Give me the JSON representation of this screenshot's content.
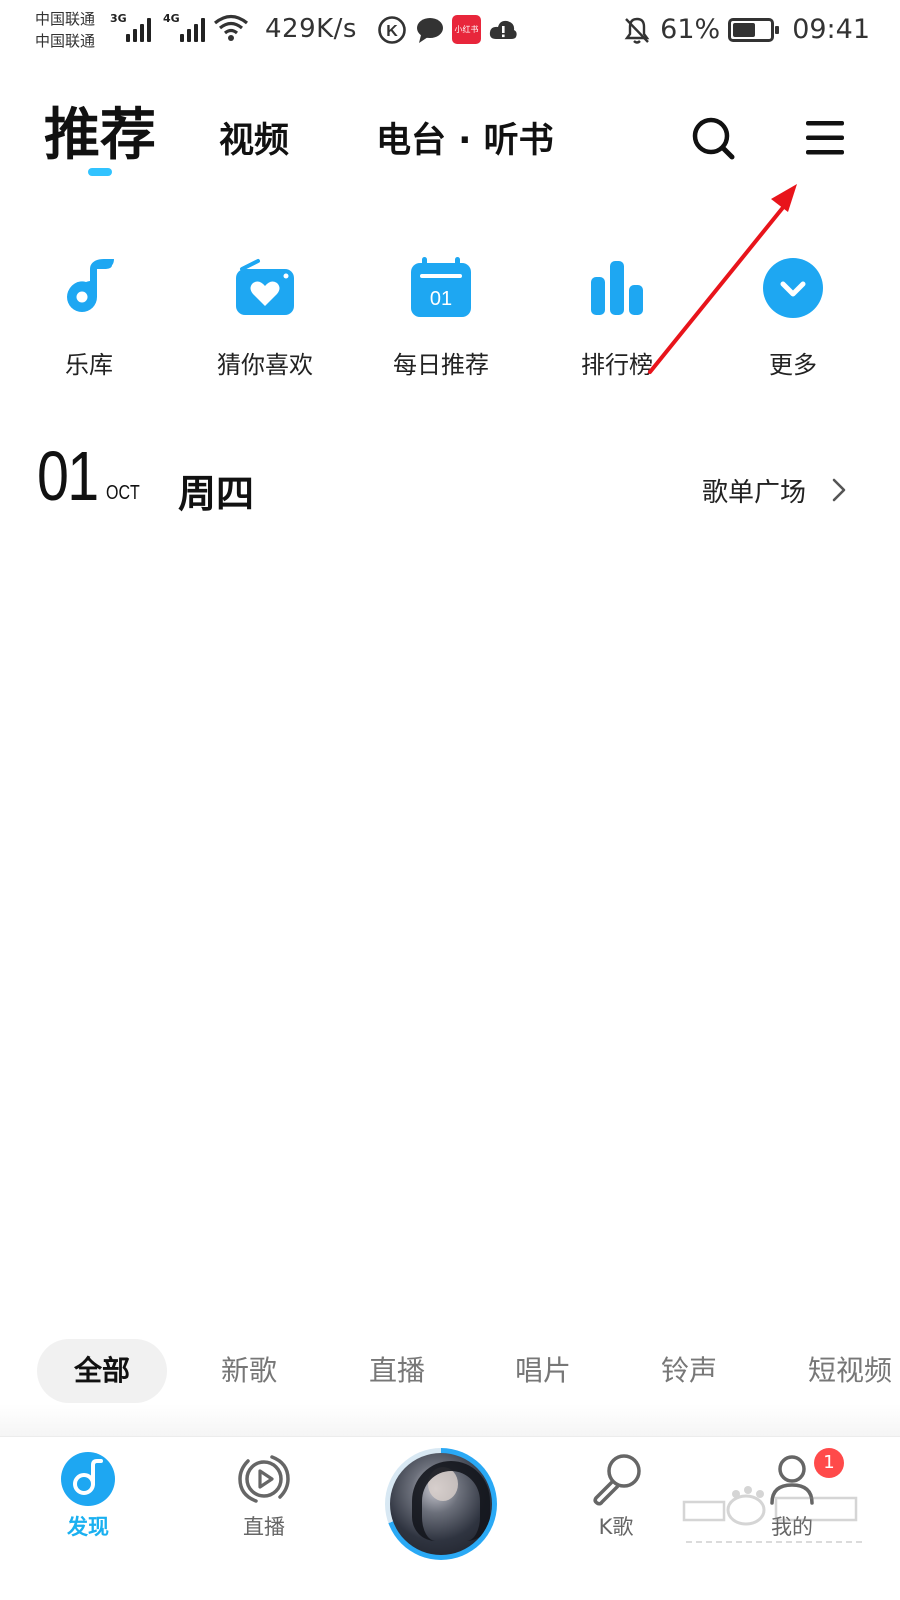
{
  "status_bar": {
    "carrier_1": "中国联通",
    "carrier_2": "中国联通",
    "network_1": "3G",
    "network_2": "4G",
    "speed": "429K/s",
    "battery": "61%",
    "battery_level": 0.61,
    "time": "09:41",
    "app_badge_text": "小红书"
  },
  "top_nav": {
    "tabs": [
      "推荐",
      "视频",
      "电台 · 听书"
    ],
    "active_index": 0
  },
  "quick_entries": [
    {
      "label": "乐库",
      "icon": "music-note-icon"
    },
    {
      "label": "猜你喜欢",
      "icon": "heart-radio-icon"
    },
    {
      "label": "每日推荐",
      "icon": "calendar-icon",
      "icon_text": "01"
    },
    {
      "label": "排行榜",
      "icon": "chart-bars-icon"
    },
    {
      "label": "更多",
      "icon": "chevron-down-circle-icon"
    }
  ],
  "date_row": {
    "day": "01",
    "month": "OCT",
    "weekday": "周四",
    "playlist_link": "歌单广场"
  },
  "chips": [
    "全部",
    "新歌",
    "直播",
    "唱片",
    "铃声",
    "短视频"
  ],
  "bottom_tabs": [
    {
      "label": "发现",
      "icon": "discover-icon",
      "active": true
    },
    {
      "label": "直播",
      "icon": "live-play-icon",
      "active": false
    },
    {
      "label": "K歌",
      "icon": "karaoke-mic-icon",
      "active": false
    },
    {
      "label": "我的",
      "icon": "profile-icon",
      "active": false
    }
  ],
  "notification_badge": "1",
  "colors": {
    "accent": "#1ab0f0",
    "icon_blue": "#1ea7f2",
    "annotation_red": "#e8141b"
  }
}
